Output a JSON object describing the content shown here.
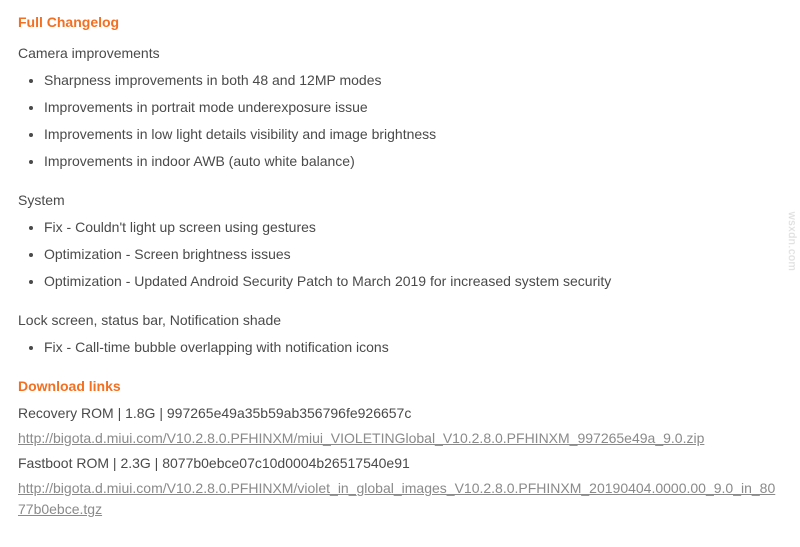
{
  "changelog": {
    "title": "Full Changelog",
    "sections": [
      {
        "heading": "Camera improvements",
        "items": [
          "Sharpness improvements in both 48 and 12MP modes",
          "Improvements in portrait mode underexposure issue",
          "Improvements in low light details visibility and image brightness",
          "Improvements in indoor AWB (auto white balance)"
        ]
      },
      {
        "heading": "System",
        "items": [
          "Fix - Couldn't light up screen using gestures",
          "Optimization - Screen brightness issues",
          "Optimization - Updated Android Security Patch to March 2019 for increased system security"
        ]
      },
      {
        "heading": "Lock screen, status bar, Notification shade",
        "items": [
          "Fix - Call-time bubble overlapping with notification icons"
        ]
      }
    ]
  },
  "downloads": {
    "title": "Download links",
    "recovery_line": "Recovery ROM | 1.8G | 997265e49a35b59ab356796fe926657c",
    "recovery_url": "http://bigota.d.miui.com/V10.2.8.0.PFHINXM/miui_VIOLETINGlobal_V10.2.8.0.PFHINXM_997265e49a_9.0.zip",
    "fastboot_line": "Fastboot ROM | 2.3G | 8077b0ebce07c10d0004b26517540e91",
    "fastboot_url": "http://bigota.d.miui.com/V10.2.8.0.PFHINXM/violet_in_global_images_V10.2.8.0.PFHINXM_20190404.0000.00_9.0_in_8077b0ebce.tgz"
  },
  "watermark": "wsxdn.com"
}
